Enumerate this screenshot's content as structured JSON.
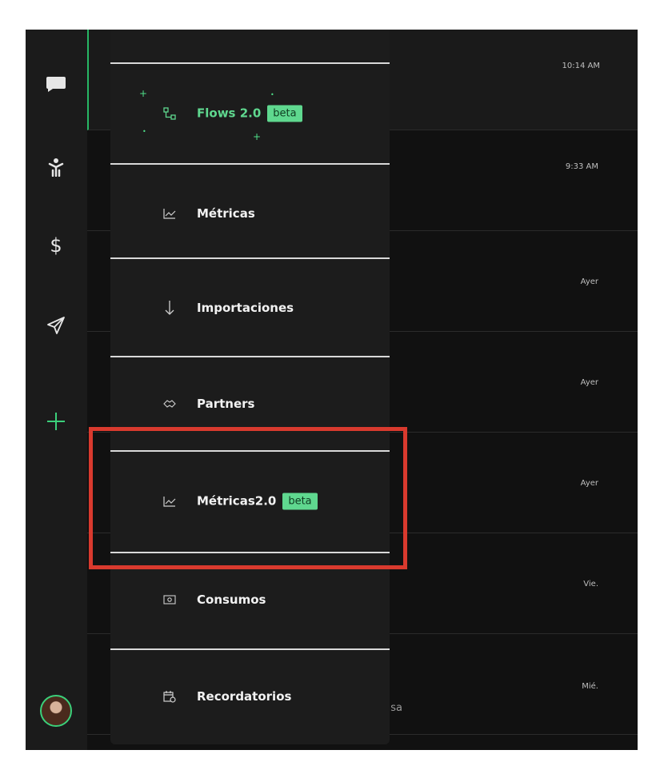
{
  "rail": {
    "icons": [
      "chat-icon",
      "person-icon",
      "dollar-icon",
      "send-icon",
      "add-icon"
    ],
    "accent": "#3bd07a"
  },
  "chats": [
    {
      "time": "10:14 AM",
      "preview": "",
      "active": true
    },
    {
      "time": "9:33 AM",
      "preview": "",
      "active": false
    },
    {
      "time": "Ayer",
      "preview": "",
      "active": false
    },
    {
      "time": "Ayer",
      "preview": "",
      "active": false
    },
    {
      "time": "Ayer",
      "preview": "",
      "active": false
    },
    {
      "time": "Vie.",
      "preview": "",
      "active": false
    },
    {
      "time": "Mié.",
      "preview": "pasa",
      "active": false
    }
  ],
  "menu": {
    "items": [
      {
        "label": "Flows 2.0",
        "badge": "beta",
        "icon": "flows-icon"
      },
      {
        "label": "Métricas",
        "icon": "chart-icon"
      },
      {
        "label": "Importaciones",
        "icon": "arrow-down-icon"
      },
      {
        "label": "Partners",
        "icon": "handshake-icon"
      },
      {
        "label": "Métricas2.0",
        "badge": "beta",
        "icon": "chart-icon"
      },
      {
        "label": "Consumos",
        "icon": "money-icon"
      },
      {
        "label": "Recordatorios",
        "icon": "calendar-clock-icon"
      }
    ]
  },
  "colors": {
    "beta_bg": "#5fd88f",
    "highlight": "#d93a2e"
  }
}
